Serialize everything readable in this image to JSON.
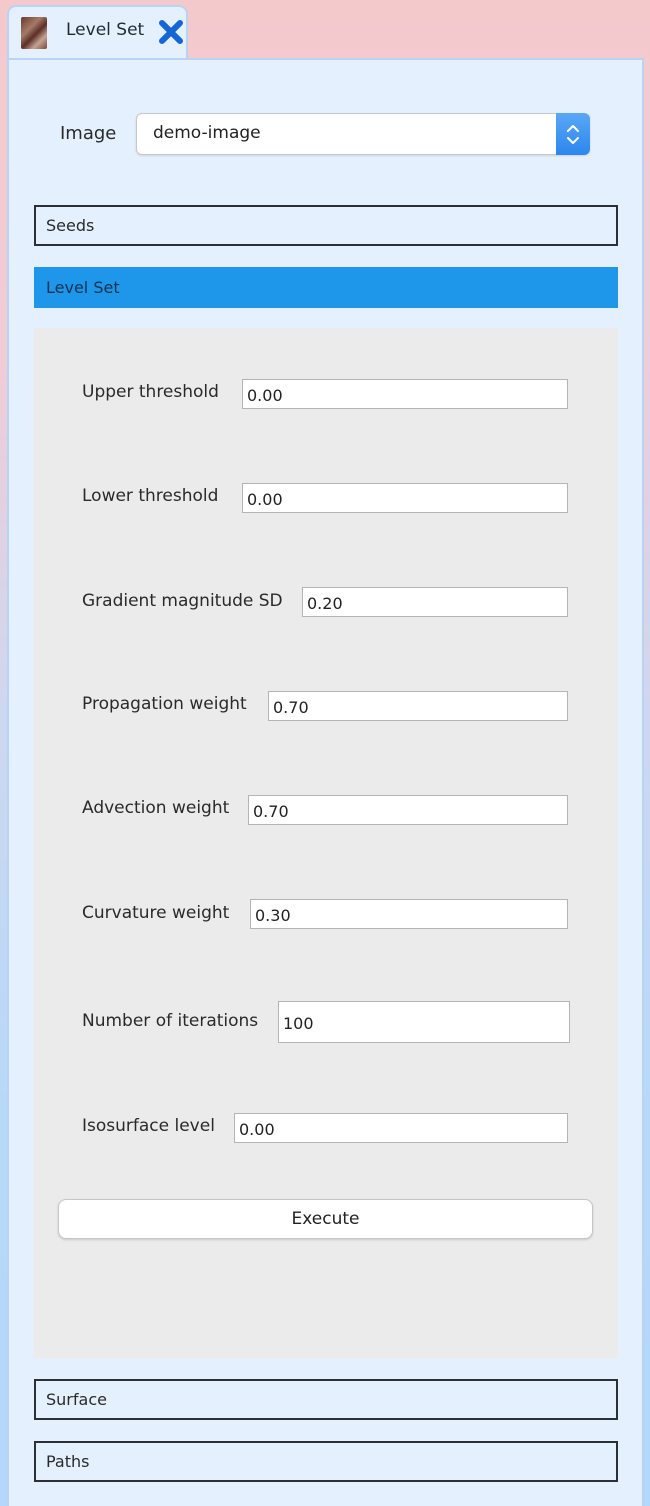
{
  "tab": {
    "label": "Level Set",
    "thumbnail_icon": "image-thumbnail-icon",
    "close_icon": "close-x-icon",
    "close_color": "#1565d8"
  },
  "image_select": {
    "label": "Image",
    "value": "demo-image",
    "arrow_icon": "updown-chevron-icon",
    "accent": "#2c86ee"
  },
  "sections": {
    "seeds": "Seeds",
    "level_set": "Level Set",
    "surface": "Surface",
    "paths": "Paths",
    "active_color": "#1e96ea"
  },
  "params": [
    {
      "label": "Upper threshold",
      "value": "0.00"
    },
    {
      "label": "Lower threshold",
      "value": "0.00"
    },
    {
      "label": "Gradient magnitude SD",
      "value": "0.20"
    },
    {
      "label": "Propagation weight",
      "value": "0.70"
    },
    {
      "label": "Advection weight",
      "value": "0.70"
    },
    {
      "label": "Curvature weight",
      "value": "0.30"
    },
    {
      "label": "Number of iterations",
      "value": "100"
    },
    {
      "label": "Isosurface level",
      "value": "0.00"
    }
  ],
  "execute_label": "Execute"
}
